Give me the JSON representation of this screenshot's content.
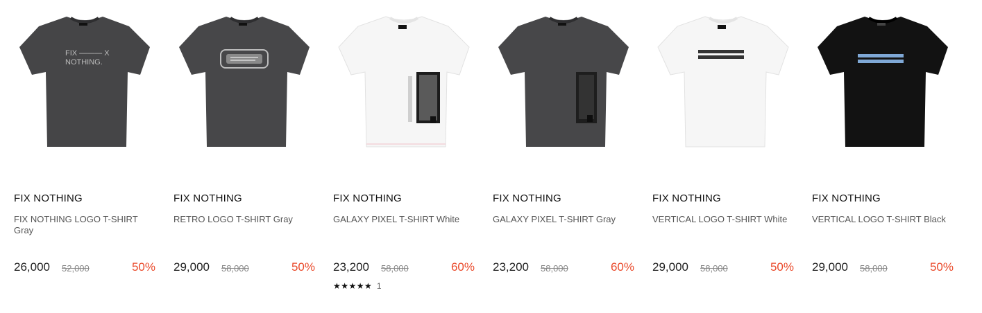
{
  "products": [
    {
      "brand": "FIX NOTHING",
      "name": "FIX NOTHING LOGO T-SHIRT Gray",
      "price": "26,000",
      "original_price": "52,000",
      "discount": "50%",
      "shirt_color": "#454547",
      "print": "text"
    },
    {
      "brand": "FIX NOTHING",
      "name": "RETRO LOGO T-SHIRT Gray",
      "price": "29,000",
      "original_price": "58,000",
      "discount": "50%",
      "shirt_color": "#474749",
      "print": "retro"
    },
    {
      "brand": "FIX NOTHING",
      "name": "GALAXY PIXEL T-SHIRT White",
      "price": "23,200",
      "original_price": "58,000",
      "discount": "60%",
      "shirt_color": "#f6f6f6",
      "print": "galaxy",
      "rating": {
        "stars": "★★★★★",
        "count": "1"
      }
    },
    {
      "brand": "FIX NOTHING",
      "name": "GALAXY PIXEL T-SHIRT Gray",
      "price": "23,200",
      "original_price": "58,000",
      "discount": "60%",
      "shirt_color": "#474749",
      "print": "galaxy"
    },
    {
      "brand": "FIX NOTHING",
      "name": "VERTICAL LOGO T-SHIRT White",
      "price": "29,000",
      "original_price": "58,000",
      "discount": "50%",
      "shirt_color": "#f6f6f6",
      "print": "vertical"
    },
    {
      "brand": "FIX NOTHING",
      "name": "VERTICAL LOGO T-SHIRT Black",
      "price": "29,000",
      "original_price": "58,000",
      "discount": "50%",
      "shirt_color": "#121212",
      "print": "vertical-blue"
    }
  ],
  "colors": {
    "discount": "#ea4a2b",
    "brand_text": "#111111",
    "name_text": "#555555",
    "strike_price": "#888888"
  }
}
